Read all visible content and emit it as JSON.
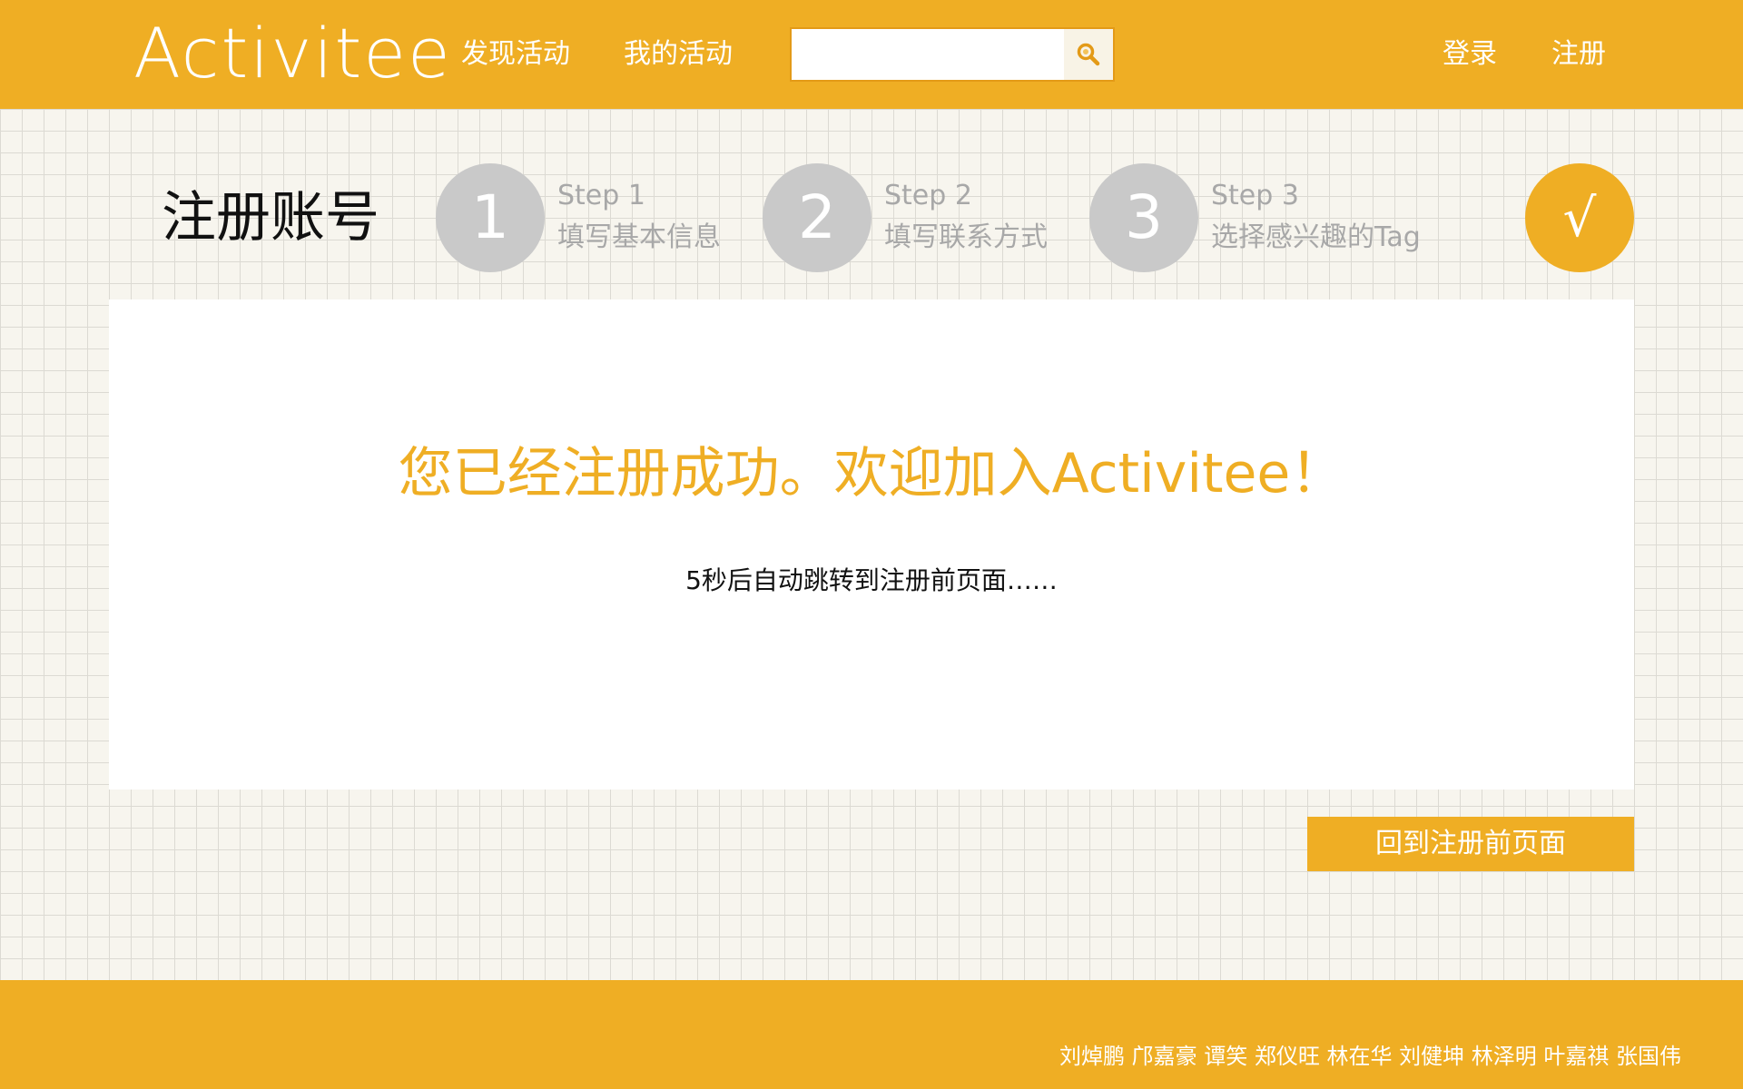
{
  "header": {
    "logo": "Activitee",
    "nav": {
      "discover": "发现活动",
      "mine": "我的活动"
    },
    "search": {
      "value": "",
      "placeholder": "",
      "button_icon": "search-icon"
    },
    "auth": {
      "login": "登录",
      "register": "注册"
    }
  },
  "page": {
    "title": "注册账号",
    "steps": [
      {
        "number": "1",
        "heading": "Step 1",
        "desc": "填写基本信息",
        "state": "completed"
      },
      {
        "number": "2",
        "heading": "Step 2",
        "desc": "填写联系方式",
        "state": "completed"
      },
      {
        "number": "3",
        "heading": "Step 3",
        "desc": "选择感兴趣的Tag",
        "state": "completed"
      }
    ],
    "done_mark": "√",
    "success_message": "您已经注册成功。欢迎加入Activitee！",
    "redirect_message": "5秒后自动跳转到注册前页面……",
    "back_button": "回到注册前页面"
  },
  "footer": {
    "credits": "刘焯鹏 邝嘉豪 谭笑 郑仪旺 林在华 刘健坤 林泽明 叶嘉祺 张国伟"
  },
  "colors": {
    "accent": "#efae24",
    "step_inactive": "#c9c9c9",
    "step_text": "#a8a8a8",
    "background": "#f7f5ee"
  }
}
